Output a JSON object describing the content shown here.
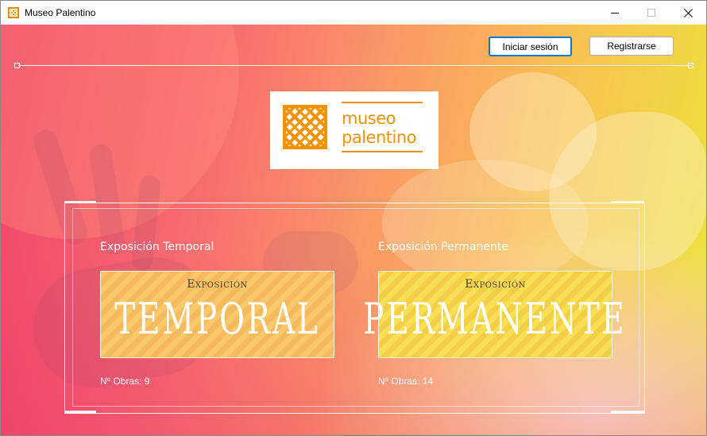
{
  "window": {
    "title": "Museo Palentino",
    "controls": [
      "minimize-icon",
      "maximize-icon",
      "close-icon"
    ]
  },
  "header": {
    "login_label": "Iniciar sesión",
    "register_label": "Registrarse"
  },
  "logo": {
    "line1": "museo",
    "line2": "palentino",
    "color": "#f39200"
  },
  "exhibitions": [
    {
      "title": "Exposición Temporal",
      "banner_small": "Exposición",
      "banner_big": "TEMPORAL",
      "count_text": "Nº Obras: 9"
    },
    {
      "title": "Exposición Permanente",
      "banner_small": "Exposición",
      "banner_big": "PERMANENTE",
      "count_text": "Nº Obras: 14"
    }
  ],
  "colors": {
    "accent": "#f39200",
    "focus": "#0078d7",
    "gradient_start": "#f0456a",
    "gradient_end": "#ece43a"
  }
}
